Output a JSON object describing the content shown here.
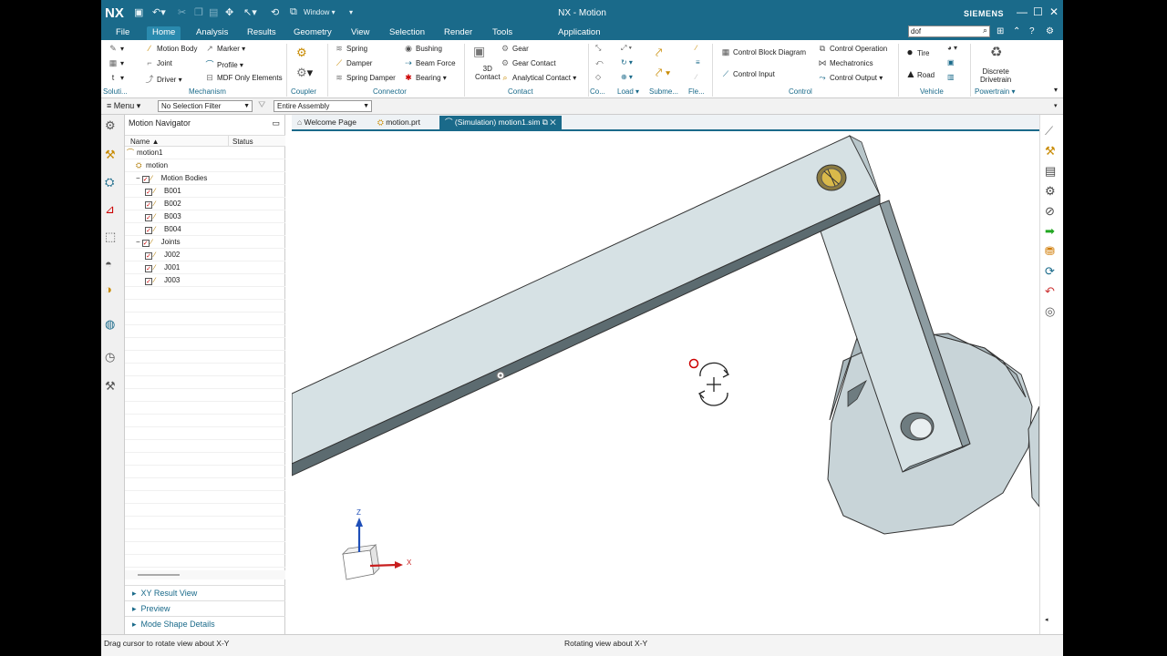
{
  "titlebar": {
    "logo": "NX",
    "title": "NX - Motion",
    "brand": "SIEMENS",
    "window_menu": "Window"
  },
  "menubar": {
    "tabs": [
      "File",
      "Home",
      "Analysis",
      "Results",
      "Geometry",
      "View",
      "Selection",
      "Render",
      "Tools",
      "Application"
    ],
    "active": "Home",
    "search_value": "dof"
  },
  "ribbon": {
    "mechanism": {
      "items": [
        "Motion Body",
        "Joint",
        "Driver",
        "Marker",
        "Profile",
        "MDF Only Elements"
      ],
      "group": "Mechanism"
    },
    "solution_group": "Soluti...",
    "coupler_group": "Coupler",
    "connector": {
      "items": [
        "Spring",
        "Damper",
        "Spring Damper",
        "Bushing",
        "Beam Force",
        "Bearing"
      ],
      "group": "Connector"
    },
    "contact": {
      "items": [
        "3D",
        "Contact",
        "Gear",
        "Gear Contact",
        "Analytical Contact"
      ],
      "group": "Contact"
    },
    "small_groups": [
      "Co...",
      "Load",
      "Subme...",
      "Fle..."
    ],
    "control": {
      "items": [
        "Control Block Diagram",
        "Control Input",
        "Control Operation",
        "Mechatronics",
        "Control Output"
      ],
      "group": "Control"
    },
    "vehicle": {
      "items": [
        "Tire",
        "Road"
      ],
      "group": "Vehicle"
    },
    "powertrain": {
      "items": [
        "Discrete",
        "Drivetrain"
      ],
      "group": "Powertrain"
    }
  },
  "selbar": {
    "menu": "Menu",
    "filter": "No Selection Filter",
    "scope": "Entire Assembly"
  },
  "navigator": {
    "title": "Motion Navigator",
    "col_name": "Name",
    "col_status": "Status",
    "rows": [
      {
        "label": "motion1",
        "indent": 0,
        "check": false
      },
      {
        "label": "motion",
        "indent": 1,
        "check": false
      },
      {
        "label": "Motion Bodies",
        "indent": 1,
        "check": true
      },
      {
        "label": "B001",
        "indent": 2,
        "check": true
      },
      {
        "label": "B002",
        "indent": 2,
        "check": true
      },
      {
        "label": "B003",
        "indent": 2,
        "check": true
      },
      {
        "label": "B004",
        "indent": 2,
        "check": true
      },
      {
        "label": "Joints",
        "indent": 1,
        "check": true
      },
      {
        "label": "J002",
        "indent": 2,
        "check": true
      },
      {
        "label": "J001",
        "indent": 2,
        "check": true
      },
      {
        "label": "J003",
        "indent": 2,
        "check": true
      }
    ],
    "panels": [
      "XY Result View",
      "Preview",
      "Mode Shape Details"
    ]
  },
  "doc_tabs": [
    "Welcome Page",
    "motion.prt",
    "(Simulation) motion1.sim"
  ],
  "axes": {
    "z": "Z",
    "x": "X"
  },
  "status": {
    "left": "Drag cursor to rotate view about X-Y",
    "center": "Rotating view about X-Y"
  }
}
